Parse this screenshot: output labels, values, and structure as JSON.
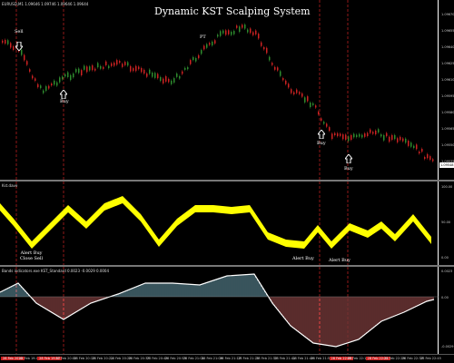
{
  "chart_title": "Dynamic KST Scalping System",
  "main_panel": {
    "label": "EURUSD,M1  1.09646 1.09746 1.09646 1.09644",
    "price_ticks": [
      "1.09670",
      "1.09655",
      "1.09640",
      "1.09625",
      "1.09610",
      "1.09595",
      "1.09580",
      "1.09565",
      "1.09550",
      "1.09535"
    ],
    "current_price": "1.09548",
    "signals": [
      {
        "label": "Sell",
        "direction": "down"
      },
      {
        "label": "Buy",
        "direction": "up"
      },
      {
        "label": "PT",
        "direction": "none"
      },
      {
        "label": "Buy",
        "direction": "up"
      },
      {
        "label": "Buy",
        "direction": "up"
      }
    ]
  },
  "osc_panel": {
    "label": "Kst.dave",
    "ticks": [
      "100.00",
      "50.00",
      "0.00"
    ],
    "annotations": [
      {
        "line1": "Alert Buy",
        "line2": "Close Sell"
      },
      {
        "line1": "Alert Buy",
        "line2": ""
      },
      {
        "line1": "Alert Buy",
        "line2": ""
      }
    ]
  },
  "hist_panel": {
    "label": "Bands indicators.exe KST_Standard 0.0023 -0.0029 0.0004",
    "ticks": [
      "0.0023",
      "0.00",
      "-0.0029"
    ]
  },
  "time_axis": {
    "labels": [
      "28 Feb 2020",
      "28 Feb 19:49",
      "28 Feb 19:57",
      "28 Feb 20:05",
      "28 Feb 20:13",
      "28 Feb 20:21",
      "28 Feb 20:29",
      "28 Feb 20:37",
      "28 Feb 20:45",
      "28 Feb 20:53",
      "28 Feb 21:01",
      "28 Feb 21:09",
      "28 Feb 21:17",
      "28 Feb 21:25",
      "28 Feb 21:33",
      "28 Feb 21:41",
      "28 Feb 21:49",
      "28 Feb 21:57",
      "28 Feb 22:05",
      "28 Feb 22:13",
      "28 Feb 22:21",
      "28 Feb 22:29",
      "28 Feb 22:37",
      "28 Feb 22:45"
    ],
    "highlighted": [
      "28 Feb 2020",
      "28 Feb 19:57",
      "28 Feb 22:05",
      "28 Feb 22:21"
    ]
  },
  "colors": {
    "bull_candle": "#2e8b2e",
    "bear_candle": "#cc2222",
    "osc_band": "#ffff00",
    "hist_positive": "#8fd3e8",
    "hist_negative": "#e07070",
    "signal_line": "#cc2222"
  }
}
